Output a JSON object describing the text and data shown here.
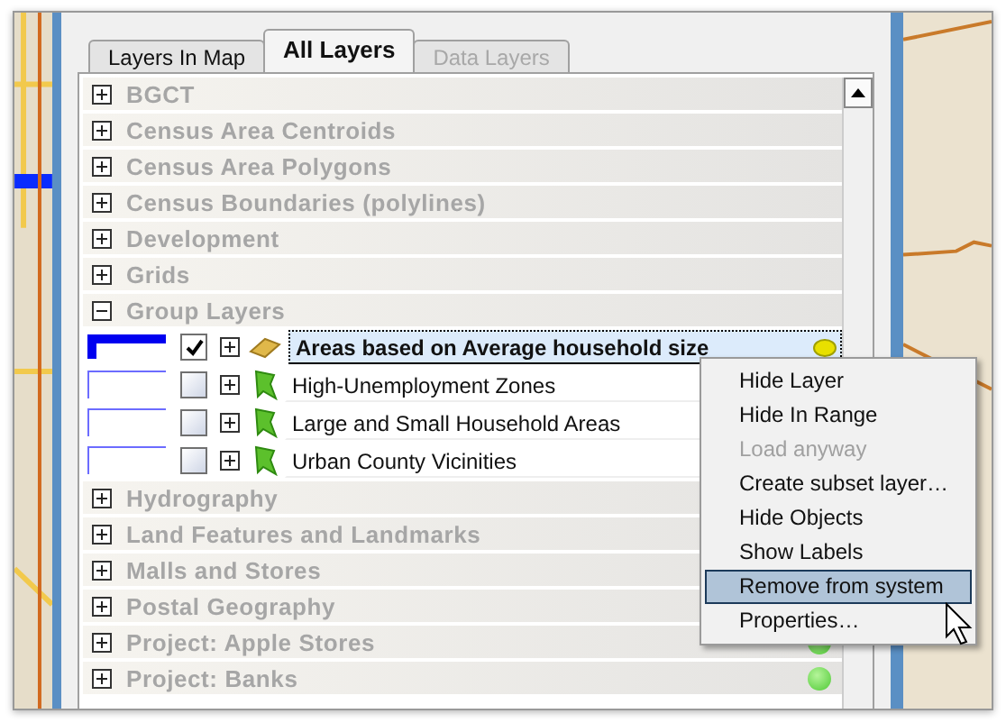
{
  "tabs": [
    {
      "label": "Layers In Map",
      "selected": false,
      "disabled": false
    },
    {
      "label": "All Layers",
      "selected": true,
      "disabled": false
    },
    {
      "label": "Data Layers",
      "selected": false,
      "disabled": true
    }
  ],
  "layers": [
    {
      "name": "BGCT",
      "expanded": false,
      "status_dot": false
    },
    {
      "name": "Census Area Centroids",
      "expanded": false,
      "status_dot": false
    },
    {
      "name": "Census Area Polygons",
      "expanded": false,
      "status_dot": false
    },
    {
      "name": "Census Boundaries (polylines)",
      "expanded": false,
      "status_dot": false
    },
    {
      "name": "Development",
      "expanded": false,
      "status_dot": false
    },
    {
      "name": "Grids",
      "expanded": false,
      "status_dot": false
    },
    {
      "name": "Group Layers",
      "expanded": true,
      "status_dot": false,
      "children": [
        {
          "name": "Areas based on Average household size",
          "checked": true,
          "selected": true,
          "kind": "area",
          "status_dot": true
        },
        {
          "name": "High-Unemployment Zones",
          "checked": false,
          "selected": false,
          "kind": "theme"
        },
        {
          "name": "Large and Small Household Areas",
          "checked": false,
          "selected": false,
          "kind": "theme"
        },
        {
          "name": "Urban County Vicinities",
          "checked": false,
          "selected": false,
          "kind": "theme"
        }
      ]
    },
    {
      "name": "Hydrography",
      "expanded": false,
      "status_dot": false
    },
    {
      "name": "Land Features and Landmarks",
      "expanded": false,
      "status_dot": false
    },
    {
      "name": "Malls and Stores",
      "expanded": false,
      "status_dot": false
    },
    {
      "name": "Postal Geography",
      "expanded": false,
      "status_dot": false
    },
    {
      "name": "Project: Apple Stores",
      "expanded": false,
      "status_dot": true
    },
    {
      "name": "Project: Banks",
      "expanded": false,
      "status_dot": true
    }
  ],
  "context_menu": [
    {
      "label": "Hide Layer",
      "disabled": false,
      "selected": false
    },
    {
      "label": "Hide In Range",
      "disabled": false,
      "selected": false
    },
    {
      "label": "Load anyway",
      "disabled": true,
      "selected": false
    },
    {
      "label": "Create subset layer…",
      "disabled": false,
      "selected": false
    },
    {
      "label": "Hide Objects",
      "disabled": false,
      "selected": false
    },
    {
      "label": "Show Labels",
      "disabled": false,
      "selected": false
    },
    {
      "label": "Remove from system",
      "disabled": false,
      "selected": true
    },
    {
      "label": "Properties…",
      "disabled": false,
      "selected": false
    }
  ]
}
